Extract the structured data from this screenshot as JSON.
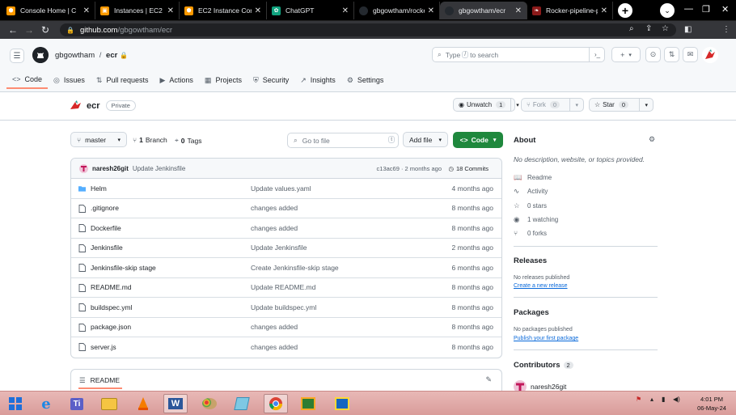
{
  "browser": {
    "tabs": [
      {
        "title": "Console Home | C",
        "color": "#ff9900"
      },
      {
        "title": "Instances | EC2 | a",
        "color": "#ff9900"
      },
      {
        "title": "EC2 Instance Conn",
        "color": "#ff9900"
      },
      {
        "title": "ChatGPT",
        "color": "#10a37f"
      },
      {
        "title": "gbgowtham/rocke",
        "color": "#24292f"
      },
      {
        "title": "gbgowtham/ecr",
        "color": "#24292f"
      },
      {
        "title": "Rocker-pipeline-p",
        "color": "#8b1a1a"
      }
    ],
    "url_host": "github.com",
    "url_path": "/gbgowtham/ecr"
  },
  "github": {
    "owner": "gbgowtham",
    "separator": "/",
    "repo": "ecr",
    "search_placeholder_a": "Type",
    "search_key": "/",
    "search_placeholder_b": "to search",
    "nav": [
      {
        "label": "Code",
        "icon": "<>"
      },
      {
        "label": "Issues",
        "icon": "◎"
      },
      {
        "label": "Pull requests",
        "icon": "⇅"
      },
      {
        "label": "Actions",
        "icon": "▶"
      },
      {
        "label": "Projects",
        "icon": "▦"
      },
      {
        "label": "Security",
        "icon": "⛨"
      },
      {
        "label": "Insights",
        "icon": "↗"
      },
      {
        "label": "Settings",
        "icon": "⚙"
      }
    ]
  },
  "repo": {
    "name": "ecr",
    "visibility": "Private",
    "watch_label": "Unwatch",
    "watch_count": "1",
    "fork_label": "Fork",
    "fork_count": "0",
    "star_label": "Star",
    "star_count": "0",
    "branch": "master",
    "branch_count": "1",
    "branch_label": "Branch",
    "tag_count": "0",
    "tag_label": "Tags",
    "goto_placeholder": "Go to file",
    "goto_key": "t",
    "add_file_label": "Add file",
    "code_label": "Code"
  },
  "last_commit": {
    "author": "naresh26git",
    "message": "Update Jenkinsfile",
    "meta": "c13ac69 · 2 months ago",
    "commits_label": "18 Commits"
  },
  "files": [
    {
      "name": "Helm",
      "type": "dir",
      "message": "Update values.yaml",
      "age": "4 months ago"
    },
    {
      "name": ".gitignore",
      "type": "file",
      "message": "changes added",
      "age": "8 months ago"
    },
    {
      "name": "Dockerfile",
      "type": "file",
      "message": "changes added",
      "age": "8 months ago"
    },
    {
      "name": "Jenkinsfile",
      "type": "file",
      "message": "Update Jenkinsfile",
      "age": "2 months ago"
    },
    {
      "name": "Jenkinsfile-skip stage",
      "type": "file",
      "message": "Create Jenkinsfile-skip stage",
      "age": "6 months ago"
    },
    {
      "name": "README.md",
      "type": "file",
      "message": "Update README.md",
      "age": "8 months ago"
    },
    {
      "name": "buildspec.yml",
      "type": "file",
      "message": "Update buildspec.yml",
      "age": "8 months ago"
    },
    {
      "name": "package.json",
      "type": "file",
      "message": "changes added",
      "age": "8 months ago"
    },
    {
      "name": "server.js",
      "type": "file",
      "message": "changes added",
      "age": "8 months ago"
    }
  ],
  "readme_tab": "README",
  "about": {
    "title": "About",
    "description": "No description, website, or topics provided.",
    "items": [
      {
        "icon": "📖",
        "label": "Readme"
      },
      {
        "icon": "∿",
        "label": "Activity"
      },
      {
        "icon": "☆",
        "label": "0 stars"
      },
      {
        "icon": "◉",
        "label": "1 watching"
      },
      {
        "icon": "⑂",
        "label": "0 forks"
      }
    ],
    "releases_title": "Releases",
    "releases_text": "No releases published",
    "releases_link": "Create a new release",
    "packages_title": "Packages",
    "packages_text": "No packages published",
    "packages_link": "Publish your first package",
    "contributors_title": "Contributors",
    "contributors_count": "2",
    "contributor_name": "naresh26git"
  },
  "taskbar": {
    "time": "4:01 PM",
    "date": "06-May-24"
  },
  "colors": {
    "accent": "#0969da",
    "code_button": "#1f883d",
    "tab_underline": "#fd8c73"
  }
}
